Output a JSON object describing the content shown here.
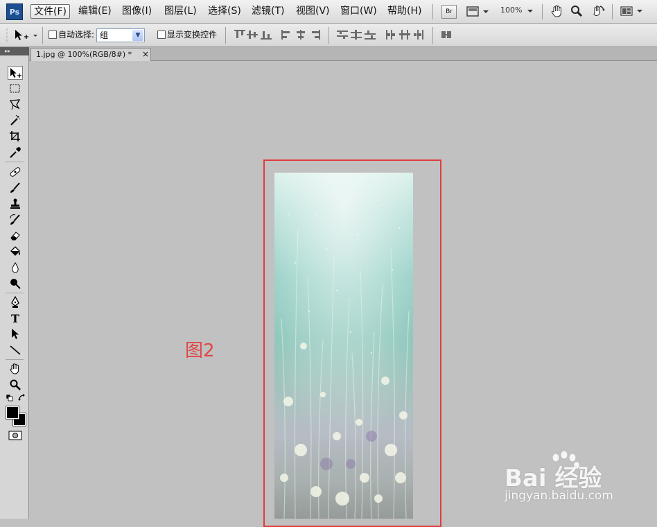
{
  "app": {
    "logo": "Ps"
  },
  "menu": [
    {
      "label": "文件(F)"
    },
    {
      "label": "编辑(E)"
    },
    {
      "label": "图像(I)"
    },
    {
      "label": "图层(L)"
    },
    {
      "label": "选择(S)"
    },
    {
      "label": "滤镜(T)"
    },
    {
      "label": "视图(V)"
    },
    {
      "label": "窗口(W)"
    },
    {
      "label": "帮助(H)"
    }
  ],
  "menubar_tools": {
    "bridge_label": "Br",
    "zoom": "100%"
  },
  "options": {
    "auto_select_label": "自动选择:",
    "auto_select_value": "组",
    "show_transform_label": "显示变换控件"
  },
  "document": {
    "tab_title": "1.jpg @ 100%(RGB/8#) *",
    "close_glyph": "×"
  },
  "annotation": {
    "label": "图2",
    "color": "#e03c3c"
  },
  "watermark": {
    "brand": "Bai  经验",
    "url": "jingyan.baidu.com"
  },
  "colors": {
    "foreground": "#000000",
    "background": "#000000"
  }
}
